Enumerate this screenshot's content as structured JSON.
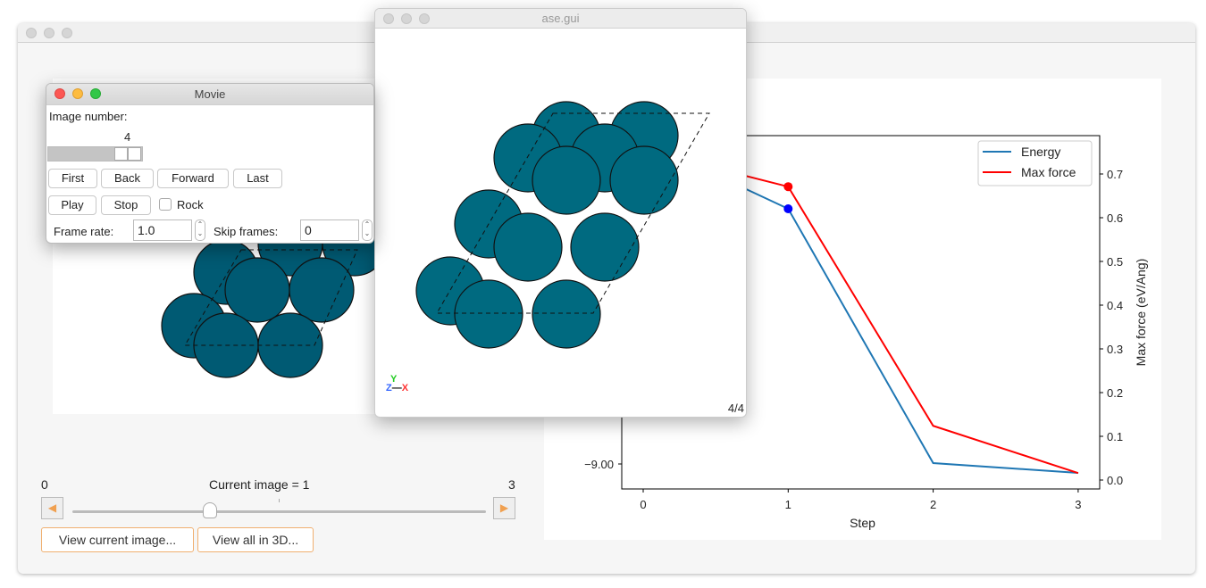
{
  "main_window": {
    "title": "",
    "slider": {
      "min_label": "0",
      "max_label": "3",
      "current_label": "Current image =",
      "current_value": "1",
      "position": 1,
      "max": 3
    },
    "buttons": {
      "view_current": "View current image...",
      "view_all_3d": "View all in 3D..."
    },
    "icons": {
      "prev": "left-arrow-icon",
      "next": "right-arrow-icon"
    }
  },
  "movie_window": {
    "title": "Movie",
    "image_number_label": "Image number:",
    "image_number_value": "4",
    "buttons": {
      "first": "First",
      "back": "Back",
      "forward": "Forward",
      "last": "Last",
      "play": "Play",
      "stop": "Stop"
    },
    "rock_label": "Rock",
    "rock_checked": false,
    "frame_rate_label": "Frame rate:",
    "frame_rate_value": "1.0",
    "skip_frames_label": "Skip frames:",
    "skip_frames_value": "0"
  },
  "ase_window": {
    "title": "ase.gui",
    "frame_counter": "4/4",
    "axes": {
      "y": "Y",
      "z": "Z",
      "x": "X"
    },
    "atom_color": "#006a80"
  },
  "chart_data": {
    "type": "line",
    "xlabel": "Step",
    "ylabel_right": "Max force (eV/Ang)",
    "x": [
      0,
      1,
      2,
      3
    ],
    "x_ticks": [
      "0",
      "1",
      "2",
      "3"
    ],
    "left_ticks": [
      "−9.00"
    ],
    "right_ticks": [
      "0.0",
      "0.1",
      "0.2",
      "0.3",
      "0.4",
      "0.5",
      "0.6",
      "0.7"
    ],
    "right_ylim": [
      -0.022,
      0.788
    ],
    "legend_position": "top-right",
    "highlight_step": 1,
    "series": [
      {
        "name": "Energy",
        "axis": "left",
        "color": "#1f77b4",
        "marker_color": "#0000ff",
        "values": [
          -8.638,
          -8.714,
          -8.999,
          -9.01
        ]
      },
      {
        "name": "Max force",
        "axis": "right",
        "color": "#ff0000",
        "marker_color": "#ff0000",
        "values": [
          0.755,
          0.671,
          0.124,
          0.016
        ]
      }
    ]
  }
}
